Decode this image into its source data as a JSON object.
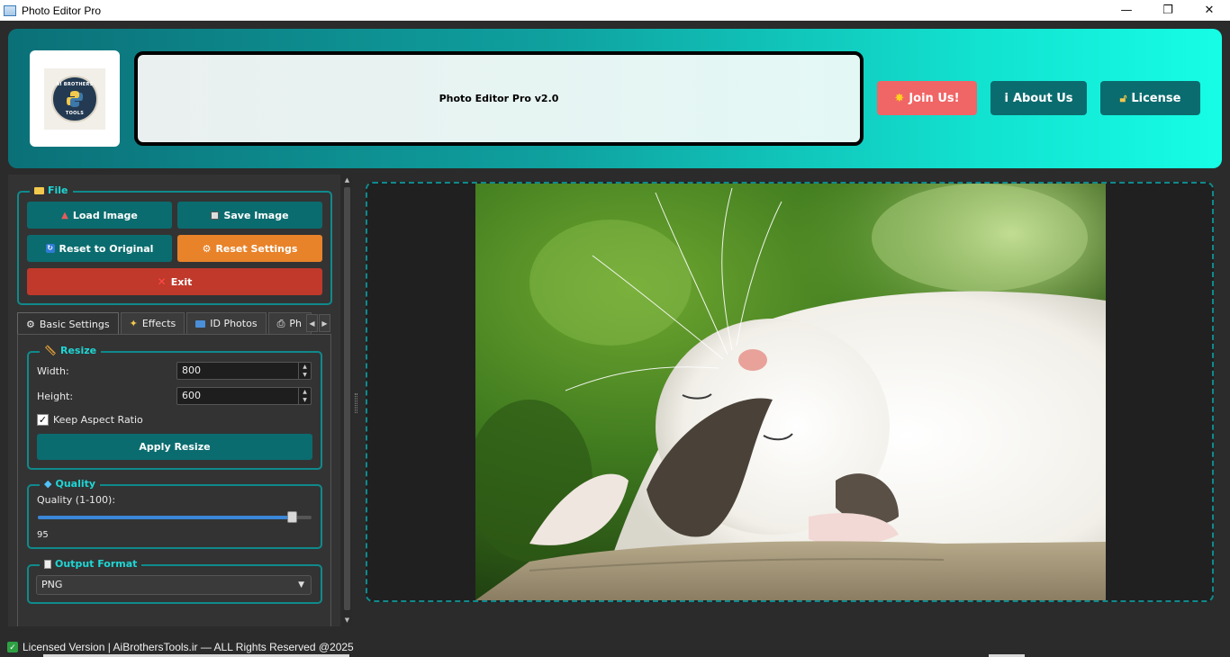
{
  "window": {
    "title": "Photo Editor Pro",
    "minimize": "—",
    "maximize": "❐",
    "close": "✕"
  },
  "header": {
    "logo_text_top": "AI BROTHERS",
    "logo_text_bottom": "TOOLS",
    "banner_text": "Photo Editor Pro v2.0",
    "join_label": "Join Us!",
    "about_label": "About Us",
    "about_icon_glyph": "i",
    "license_label": "License"
  },
  "file_group": {
    "title": "File",
    "load_label": "Load Image",
    "save_label": "Save Image",
    "reset_original_label": "Reset to Original",
    "reset_settings_label": "Reset Settings",
    "exit_label": "Exit"
  },
  "tabs": [
    {
      "label": "Basic Settings",
      "icon": "gear-icon"
    },
    {
      "label": "Effects",
      "icon": "sparkle-icon"
    },
    {
      "label": "ID Photos",
      "icon": "id-card-icon"
    },
    {
      "label": "Ph",
      "icon": "printer-icon"
    }
  ],
  "resize_group": {
    "title": "Resize",
    "width_label": "Width:",
    "width_value": "800",
    "height_label": "Height:",
    "height_value": "600",
    "keep_aspect_label": "Keep Aspect Ratio",
    "keep_aspect_checked": true,
    "apply_label": "Apply Resize"
  },
  "quality_group": {
    "title": "Quality",
    "label": "Quality (1-100):",
    "value": 95,
    "value_text": "95",
    "min": 1,
    "max": 100
  },
  "format_group": {
    "title": "Output Format",
    "selected": "PNG"
  },
  "status": {
    "text": "Licensed Version | AiBrothersTools.ir — ALL Rights Reserved @2025"
  },
  "colors": {
    "accent": "#0b6c6f",
    "accent_light": "#1fd6d4",
    "join": "#f06565",
    "reset_settings": "#e8832a",
    "exit": "#c0392b"
  }
}
